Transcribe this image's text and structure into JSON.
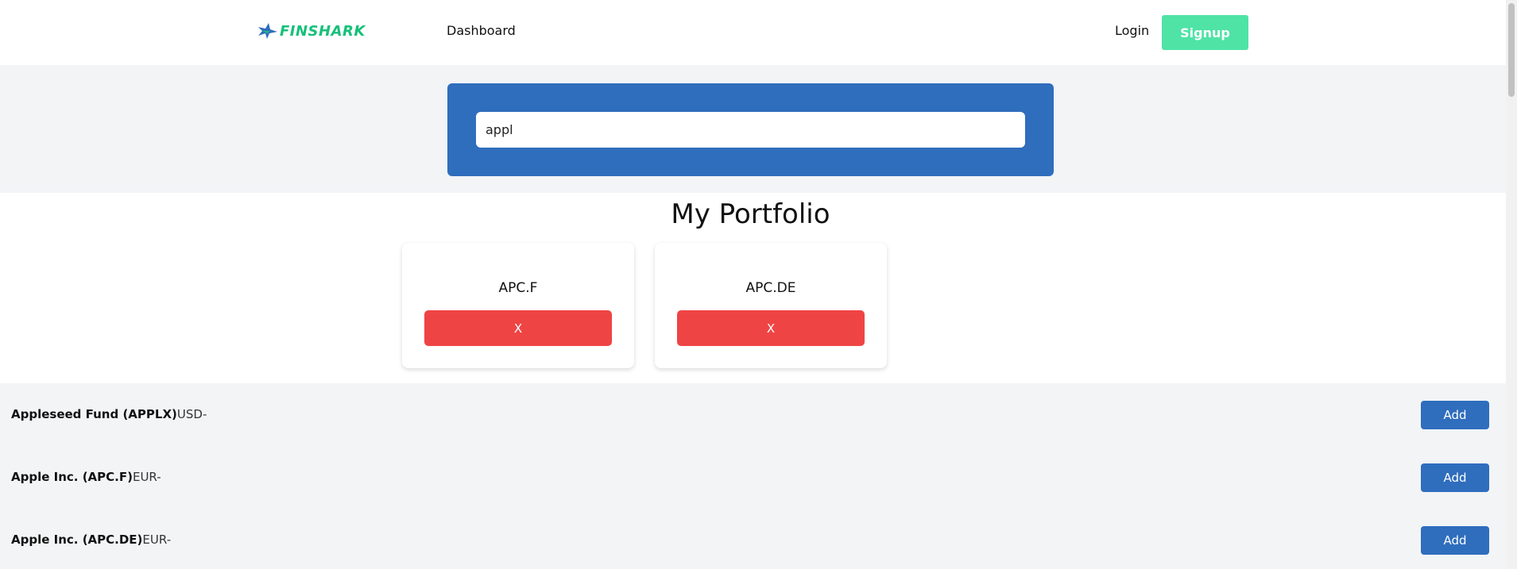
{
  "nav": {
    "logo_text": "FINSHARK",
    "dashboard_label": "Dashboard",
    "login_label": "Login",
    "signup_label": "Signup"
  },
  "search": {
    "value": "appl"
  },
  "portfolio": {
    "title": "My Portfolio",
    "items": [
      {
        "symbol": "APC.F",
        "remove_label": "X"
      },
      {
        "symbol": "APC.DE",
        "remove_label": "X"
      }
    ]
  },
  "results": [
    {
      "name": "Appleseed Fund (APPLX)",
      "extra": "USD-",
      "add_label": "Add"
    },
    {
      "name": "Apple Inc. (APC.F)",
      "extra": "EUR-",
      "add_label": "Add"
    },
    {
      "name": "Apple Inc. (APC.DE)",
      "extra": "EUR-",
      "add_label": "Add"
    }
  ],
  "colors": {
    "brand_green": "#16c07a",
    "signup_bg": "#4fe3a6",
    "primary_blue": "#2f6dbd",
    "danger_red": "#ef4444"
  }
}
